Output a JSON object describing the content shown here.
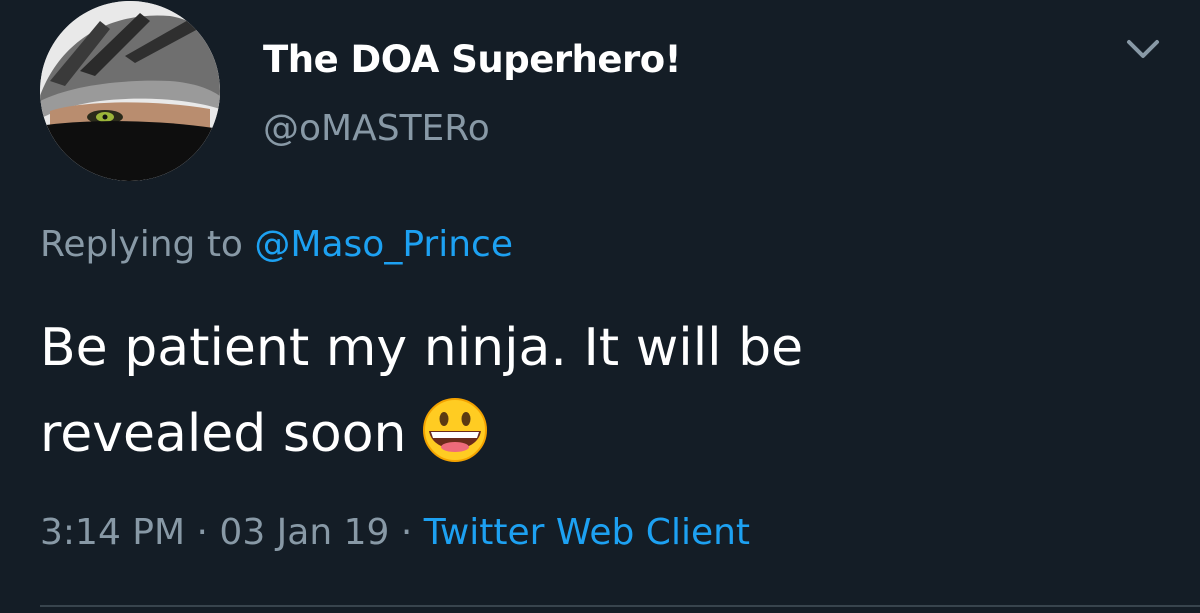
{
  "tweet": {
    "author": {
      "display_name": "The DOA Superhero!",
      "handle": "@oMASTERo",
      "avatar_icon": "ninja-avatar"
    },
    "menu_icon": "chevron-down-icon",
    "replying_prefix": "Replying to",
    "replying_to": "@Maso_Prince",
    "text_line1": "Be patient my ninja. It will be",
    "text_line2": "revealed soon",
    "emoji": "grinning-face-emoji",
    "time": "3:14 PM",
    "separator": "·",
    "date": "03 Jan 19",
    "client": "Twitter Web Client"
  },
  "colors": {
    "background": "#141d26",
    "primary_text": "#ffffff",
    "secondary_text": "#8899a6",
    "link": "#1da1f2"
  }
}
